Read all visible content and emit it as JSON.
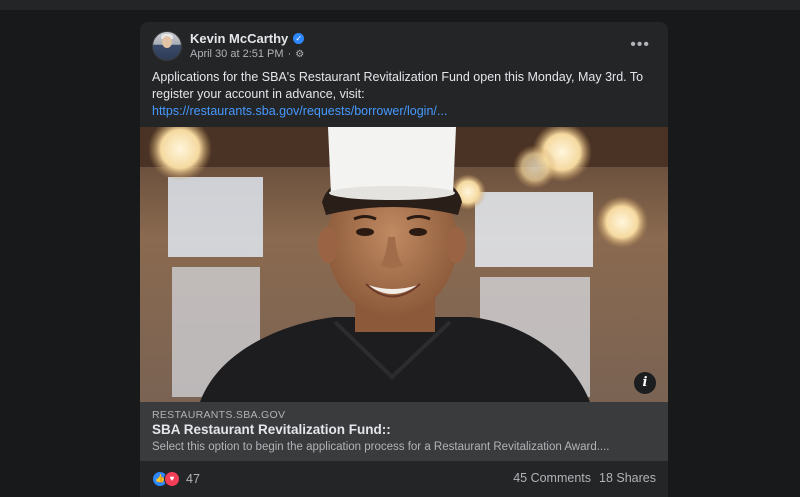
{
  "post": {
    "author": "Kevin McCarthy",
    "timestamp": "April 30 at 2:51 PM",
    "separator": "·",
    "text": "Applications for the SBA's Restaurant Revitalization Fund open this Monday, May 3rd. To register your account in advance, visit:",
    "link": "https://restaurants.sba.gov/requests/borrower/login/...",
    "more_label": "•••"
  },
  "preview": {
    "domain": "RESTAURANTS.SBA.GOV",
    "title": "SBA Restaurant Revitalization Fund::",
    "description": "Select this option to begin the application process for a Restaurant Revitalization Award...."
  },
  "footer": {
    "reaction_count": "47",
    "comments": "45 Comments",
    "shares": "18 Shares"
  },
  "icons": {
    "verified": "verified-badge-icon",
    "audience": "gear-icon",
    "info": "info-icon",
    "like": "like-icon",
    "love": "love-icon"
  },
  "colors": {
    "background": "#18191a",
    "card": "#242526",
    "link": "#4599ff",
    "like": "#2d88ff",
    "love": "#f33e58"
  }
}
